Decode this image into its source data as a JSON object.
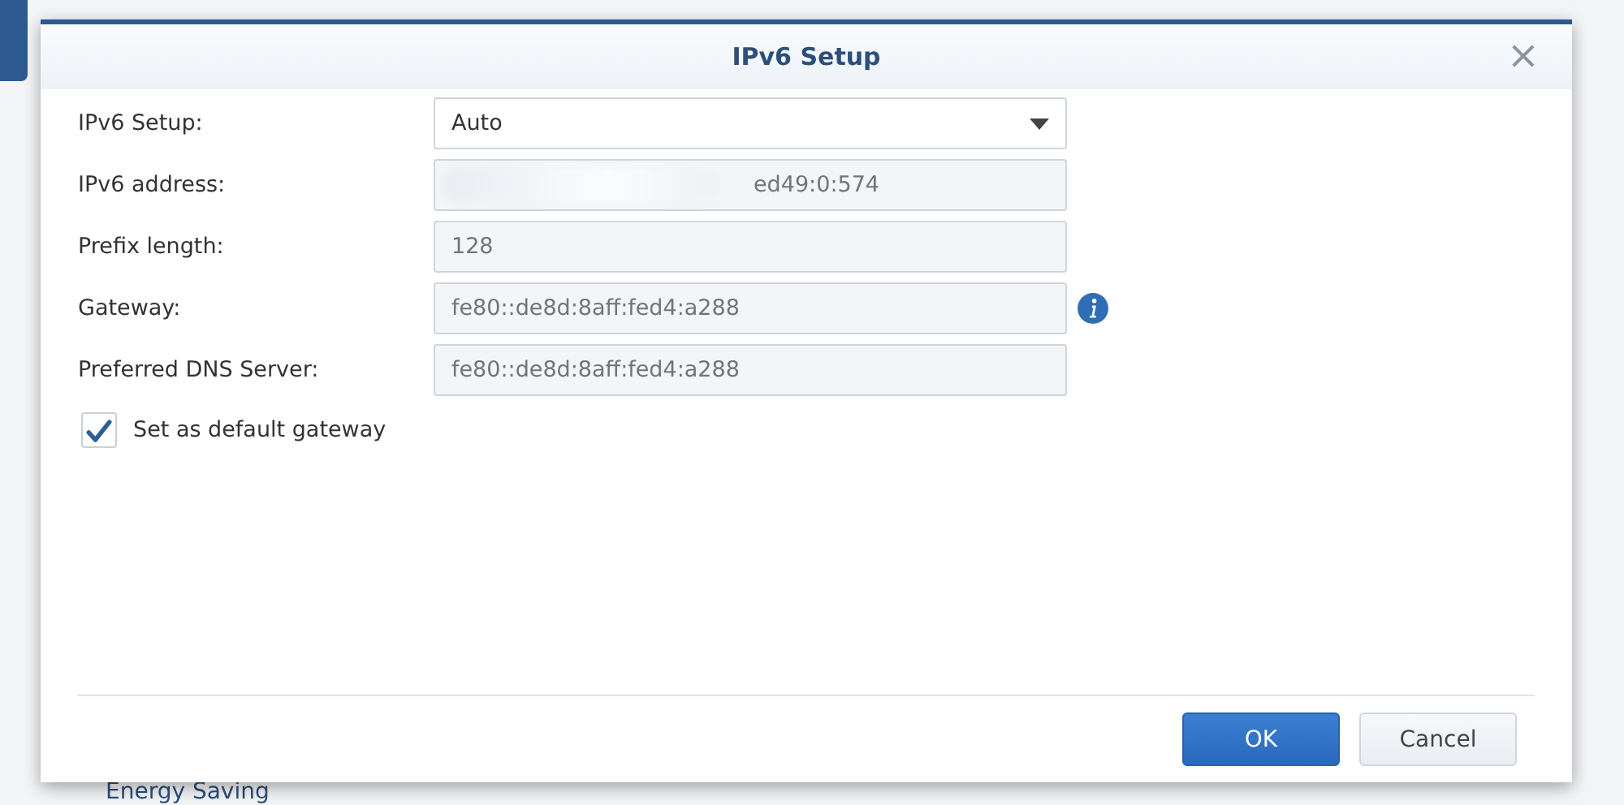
{
  "dialog": {
    "title": "IPv6 Setup",
    "close": "×"
  },
  "fields": [
    {
      "kind": "select",
      "label": "IPv6 Setup:",
      "value": "Auto",
      "disabled": false,
      "info": false
    },
    {
      "kind": "text",
      "label": "IPv6 address:",
      "value": "ed49:0:574",
      "disabled": true,
      "info": false,
      "obscured": true
    },
    {
      "kind": "text",
      "label": "Prefix length:",
      "value": "128",
      "disabled": true,
      "info": false
    },
    {
      "kind": "text",
      "label": "Gateway:",
      "value": "fe80::de8d:8aff:fed4:a288",
      "disabled": true,
      "info": true
    },
    {
      "kind": "text",
      "label": "Preferred DNS Server:",
      "value": "fe80::de8d:8aff:fed4:a288",
      "disabled": true,
      "info": false
    }
  ],
  "checkbox": {
    "label": "Set as default gateway",
    "checked": true
  },
  "buttons": [
    {
      "label": "OK",
      "kind": "primary"
    },
    {
      "label": "Cancel",
      "kind": "secondary"
    }
  ],
  "background": {
    "heading": "Energy Saving"
  }
}
